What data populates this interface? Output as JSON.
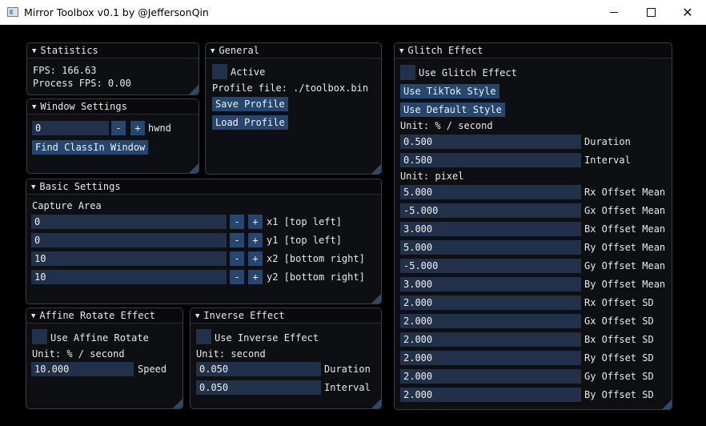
{
  "window": {
    "title": "Mirror Toolbox v0.1 by @JeffersonQin",
    "minimize": "–",
    "maximize": "□",
    "close": "✕"
  },
  "statistics": {
    "title": "Statistics",
    "fps": "FPS: 166.63",
    "process_fps": "Process FPS: 0.00"
  },
  "window_settings": {
    "title": "Window Settings",
    "hwnd_value": "0",
    "minus": "-",
    "plus": "+",
    "hwnd_label": "hwnd",
    "find_button": "Find ClassIn Window"
  },
  "general": {
    "title": "General",
    "active_label": "Active",
    "profile_file": "Profile file: ./toolbox.bin",
    "save_button": "Save Profile",
    "load_button": "Load Profile"
  },
  "basic_settings": {
    "title": "Basic Settings",
    "capture_area": "Capture Area",
    "rows": [
      {
        "value": "0",
        "minus": "-",
        "plus": "+",
        "label": "x1 [top left]"
      },
      {
        "value": "0",
        "minus": "-",
        "plus": "+",
        "label": "y1 [top left]"
      },
      {
        "value": "10",
        "minus": "-",
        "plus": "+",
        "label": "x2 [bottom right]"
      },
      {
        "value": "10",
        "minus": "-",
        "plus": "+",
        "label": "y2 [bottom right]"
      }
    ]
  },
  "affine": {
    "title": "Affine Rotate Effect",
    "use_label": "Use Affine Rotate",
    "unit": "Unit: % / second",
    "speed_value": "10.000",
    "speed_label": "Speed"
  },
  "inverse": {
    "title": "Inverse Effect",
    "use_label": "Use Inverse Effect",
    "unit": "Unit: second",
    "duration_value": "0.050",
    "duration_label": "Duration",
    "interval_value": "0.050",
    "interval_label": "Interval"
  },
  "glitch": {
    "title": "Glitch Effect",
    "use_label": "Use Glitch Effect",
    "tiktok_button": "Use TikTok Style",
    "default_button": "Use Default Style",
    "unit_time": "Unit: % / second",
    "duration_value": "0.500",
    "duration_label": "Duration",
    "interval_value": "0.500",
    "interval_label": "Interval",
    "unit_pixel": "Unit: pixel",
    "rows": [
      {
        "value": "5.000",
        "label": "Rx Offset Mean"
      },
      {
        "value": "-5.000",
        "label": "Gx Offset Mean"
      },
      {
        "value": "3.000",
        "label": "Bx Offset Mean"
      },
      {
        "value": "5.000",
        "label": "Ry Offset Mean"
      },
      {
        "value": "-5.000",
        "label": "Gy Offset Mean"
      },
      {
        "value": "3.000",
        "label": "By Offset Mean"
      },
      {
        "value": "2.000",
        "label": "Rx Offset SD"
      },
      {
        "value": "2.000",
        "label": "Gx Offset SD"
      },
      {
        "value": "2.000",
        "label": "Bx Offset SD"
      },
      {
        "value": "2.000",
        "label": "Ry Offset SD"
      },
      {
        "value": "2.000",
        "label": "Gy Offset SD"
      },
      {
        "value": "2.000",
        "label": "By Offset SD"
      }
    ]
  }
}
